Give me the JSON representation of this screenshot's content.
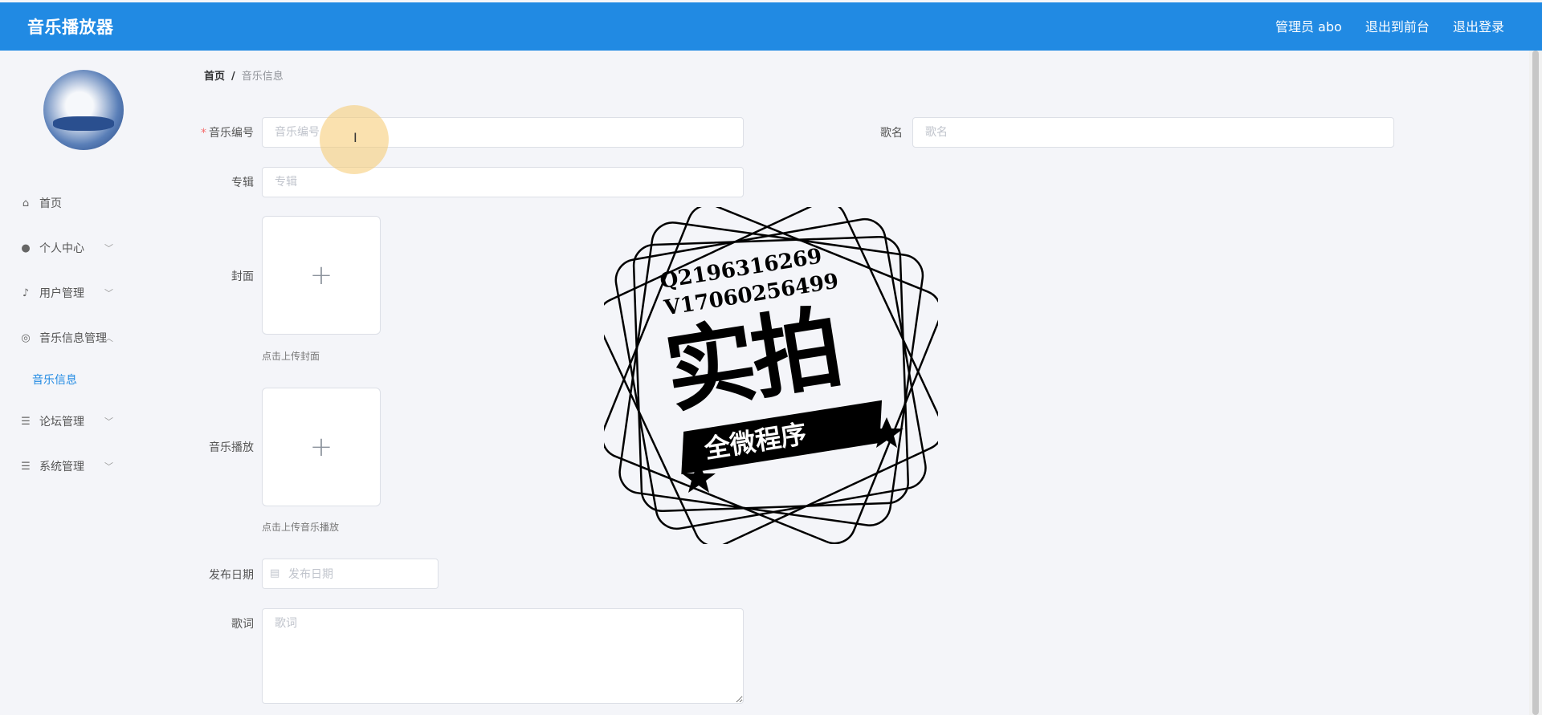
{
  "app": {
    "title": "音乐播放器"
  },
  "header": {
    "user_label": "管理员 abo",
    "front_link": "退出到前台",
    "logout_link": "退出登录"
  },
  "sidebar": {
    "items": [
      {
        "label": "首页",
        "icon": "home-icon"
      },
      {
        "label": "个人中心",
        "icon": "user-icon"
      },
      {
        "label": "用户管理",
        "icon": "mic-icon"
      },
      {
        "label": "音乐信息管理",
        "icon": "compass-icon",
        "expanded": true,
        "children": [
          {
            "label": "音乐信息",
            "active": true
          }
        ]
      },
      {
        "label": "论坛管理",
        "icon": "list-icon"
      },
      {
        "label": "系统管理",
        "icon": "list-icon"
      }
    ]
  },
  "breadcrumb": {
    "home": "首页",
    "separator": "/",
    "current": "音乐信息"
  },
  "form": {
    "music_no": {
      "label": "音乐编号",
      "required_mark": "*",
      "placeholder": "音乐编号",
      "value": ""
    },
    "song_name": {
      "label": "歌名",
      "placeholder": "歌名",
      "value": ""
    },
    "album": {
      "label": "专辑",
      "placeholder": "专辑",
      "value": ""
    },
    "cover": {
      "label": "封面",
      "hint": "点击上传封面",
      "plus": "+"
    },
    "audio": {
      "label": "音乐播放",
      "hint": "点击上传音乐播放",
      "plus": "+"
    },
    "release_date": {
      "label": "发布日期",
      "placeholder": "发布日期",
      "value": ""
    },
    "lyrics": {
      "label": "歌词",
      "placeholder": "歌词",
      "value": ""
    }
  },
  "watermark": {
    "qq": "Q2196316269",
    "wechat": "V17060256499",
    "main": "实拍",
    "sub": "全微程序"
  },
  "colors": {
    "header": "#218ae3",
    "accent": "#218ae3",
    "required": "#f56c6c"
  }
}
